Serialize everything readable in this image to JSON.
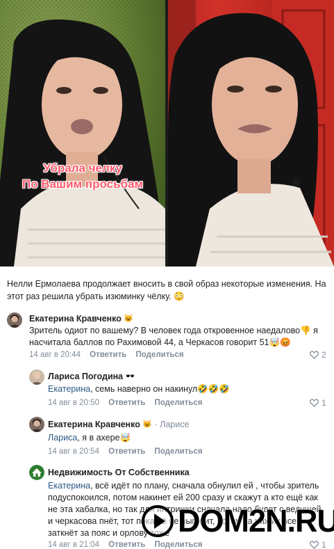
{
  "photo": {
    "overlay_line1": "Убрала челку",
    "overlay_line2": "По Вашим просьбам"
  },
  "post": {
    "text": "Нелли Ермолаева продолжает вносить в свой образ некоторые изменения. На этот раз решила убрать изюминку чёлку. 😳"
  },
  "comments": [
    {
      "author": "Екатерина Кравченко",
      "author_badge": "😺",
      "text": "Зритель одиот по вашему? В человек года откровенное наедалово👎 я насчитала баллов по Рахимовой 44, а Черкасов говорит 51🤯😡",
      "time": "14 авг в 20:44",
      "reply_label": "Ответить",
      "share_label": "Поделиться",
      "likes": "2"
    },
    {
      "author": "Лариса Погодина",
      "author_badge": "🕶️",
      "reply_to": "Екатерина",
      "text": ", семь наверно он накинул🤣🤣🤣",
      "time": "14 авг в 20:50",
      "reply_label": "Ответить",
      "share_label": "Поделиться",
      "likes": "1"
    },
    {
      "author": "Екатерина Кравченко",
      "author_badge": "😺",
      "to_label": "· Ларисе",
      "reply_to": "Лариса",
      "text": ", я в ахере🤯",
      "time": "14 авг в 20:54",
      "reply_label": "Ответить",
      "share_label": "Поделиться"
    },
    {
      "author": "Недвижимость От Собственника",
      "reply_to": "Екатерина",
      "text": ", всё идёт по плану, сначала обнулил ей , чтобы зритель подуспокоился, потом накинет ей 200 сразу и скажут а кто ещё как не эта хабалка, но так для интрижки сначала надо будет с ведущей и черкасова пнёт, тот пока её не выгонит, потом за них их все заткнёт за пояс и орлову тоже",
      "time": "14 авг в 21:04",
      "reply_label": "Ответить",
      "share_label": "Поделиться",
      "likes": "1"
    }
  ],
  "watermark": {
    "text": "DOM2N.RU"
  },
  "colors": {
    "link": "#2a5885",
    "meta": "#818c99",
    "overlay_text": "#ff5b6e"
  }
}
